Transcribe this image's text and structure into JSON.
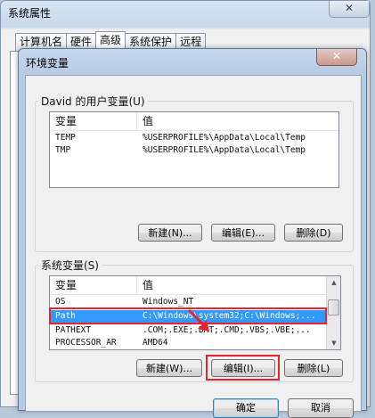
{
  "parent_dialog": {
    "title": "系统属性",
    "close_glyph": "✕",
    "tabs": [
      "计算机名",
      "硬件",
      "高级",
      "系统保护",
      "远程"
    ],
    "active_tab": 2
  },
  "env_dialog": {
    "title": "环境变量",
    "close_glyph": "✕",
    "user_group_label": "David 的用户变量(U)",
    "user_table": {
      "headers": [
        "变量",
        "值"
      ],
      "rows": [
        {
          "name": "TEMP",
          "value": "%USERPROFILE%\\AppData\\Local\\Temp"
        },
        {
          "name": "TMP",
          "value": "%USERPROFILE%\\AppData\\Local\\Temp"
        }
      ]
    },
    "user_buttons": {
      "new": "新建(N)...",
      "edit": "编辑(E)...",
      "delete": "删除(D)"
    },
    "system_group_label": "系统变量(S)",
    "system_table": {
      "headers": [
        "变量",
        "值"
      ],
      "rows": [
        {
          "name": "OS",
          "value": "Windows_NT"
        },
        {
          "name": "Path",
          "value": "C:\\Windows\\system32;C:\\Windows;..."
        },
        {
          "name": "PATHEXT",
          "value": ".COM;.EXE;.BAT;.CMD;.VBS;.VBE;..."
        },
        {
          "name": "PROCESSOR_AR",
          "value": "AMD64"
        }
      ],
      "selected_index": 1
    },
    "system_buttons": {
      "new": "新建(W)...",
      "edit": "编辑(I)...",
      "delete": "删除(L)"
    },
    "ok_button": "确定",
    "cancel_button": "取消"
  },
  "colors": {
    "selection": "#3399ff",
    "highlight": "#e8232f"
  }
}
